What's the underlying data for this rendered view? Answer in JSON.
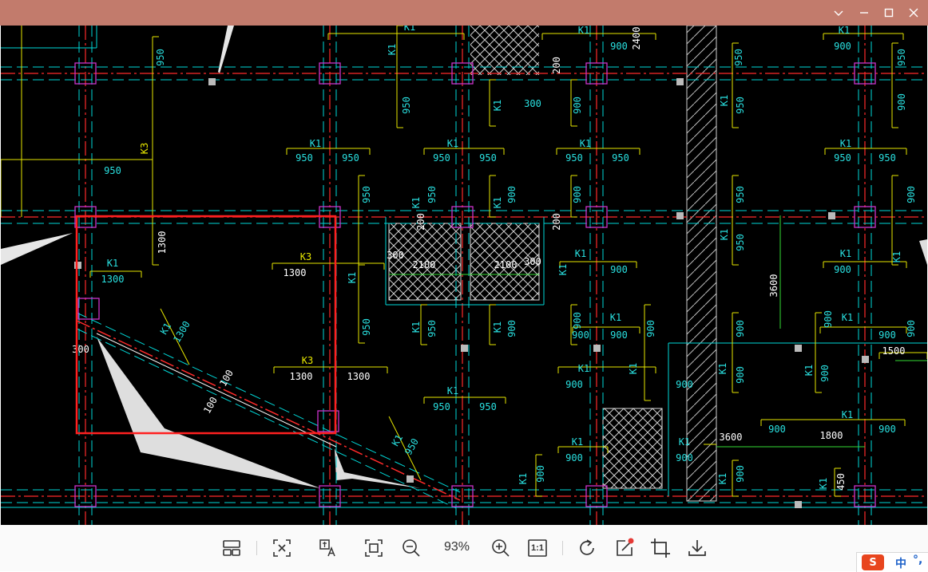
{
  "window": {
    "controls": [
      "chevron-down",
      "minimize",
      "maximize",
      "close"
    ]
  },
  "toolbar": {
    "zoom_level": "93%",
    "actual_size_label": "1:1",
    "buttons": [
      "thumbnail-layout",
      "ocr-extract",
      "translate",
      "fit-window",
      "zoom-out",
      "zoom-in",
      "actual-size",
      "rotate",
      "edit",
      "crop",
      "download"
    ]
  },
  "ime": {
    "mode": "中",
    "punct": "°,"
  },
  "drawing": {
    "labels": {
      "k1": "K1",
      "k3": "K3",
      "d950": "950",
      "d900": "900",
      "d1300": "1300",
      "d1800": "1800",
      "d1500": "1500",
      "d300": "300",
      "d200": "200",
      "d100": "100",
      "d450": "450",
      "d2100": "2100",
      "d2400": "2400",
      "d3600": "3600"
    }
  },
  "colors": {
    "titlebar": "#c27b6c",
    "canvas": "#000000",
    "grid_axis": "#ff2a2a",
    "wall_line": "#00d7d7",
    "dimension_line": "#e6e600",
    "dimension_text": "#29e0e0",
    "column": "#cc33cc",
    "selection": "#ff2020",
    "toolbar_bg": "#fafafa"
  }
}
